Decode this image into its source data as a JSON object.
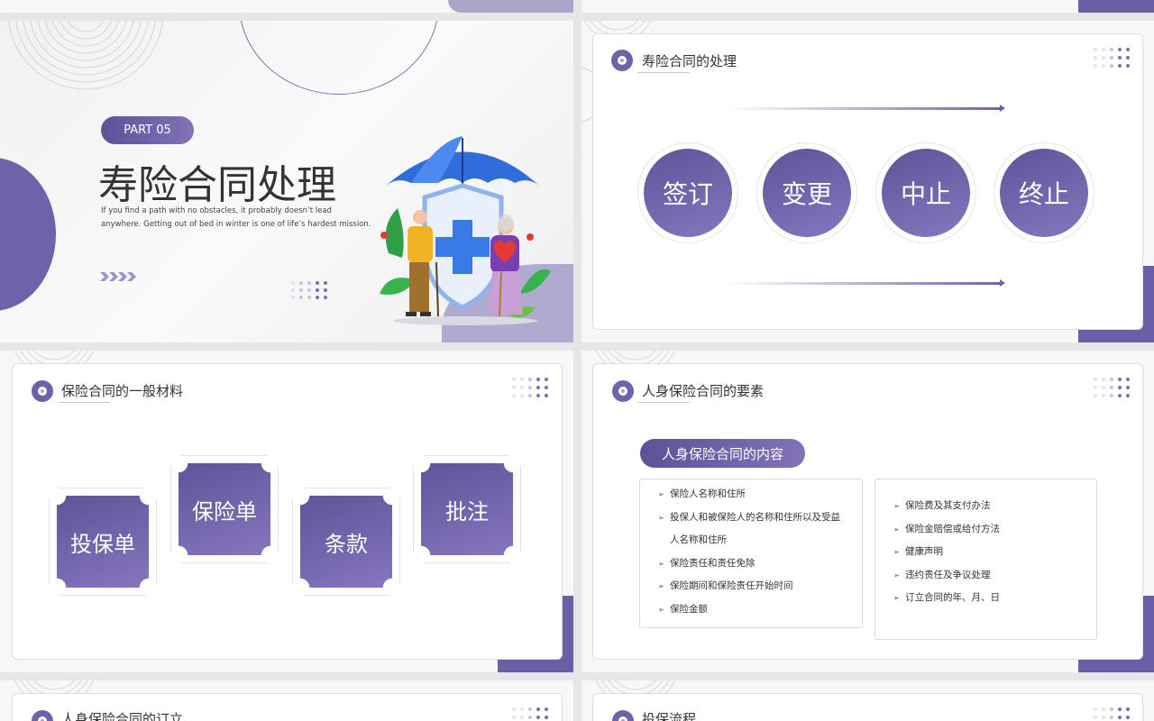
{
  "colors": {
    "accent": "#6e63aa",
    "accent_light": "#8677bf",
    "bg": "#e6e6e6"
  },
  "slide1": {
    "part_label": "PART 05",
    "title": "寿险合同处理",
    "subtitle_line1": "If you find a path with no obstacles, it probably doesn’t lead",
    "subtitle_line2": "anywhere. Getting out of bed in winter is one of life’s hardest mission.",
    "chevrons": "››››",
    "illustration": "umbrella-shield-elderly-couple"
  },
  "slide2": {
    "title": "寿险合同的处理",
    "items": [
      "签订",
      "变更",
      "中止",
      "终止"
    ]
  },
  "slide3": {
    "title": "保险合同的一般材料",
    "items": [
      "投保单",
      "保险单",
      "条款",
      "批注"
    ]
  },
  "slide4": {
    "title": "人身保险合同的要素",
    "pill": "人身保险合同的内容",
    "left_list": [
      "保险人名称和住所",
      "投保人和被保险人的名称和住所以及受益",
      "人名称和住所",
      "保险责任和责任免除",
      "保险期间和保险责任开始时间",
      "保险金额"
    ],
    "right_list": [
      "保险费及其支付办法",
      "保险金赔偿或给付方法",
      "健康声明",
      "违约责任及争议处理",
      "订立合同的年、月、日"
    ]
  },
  "slide5": {
    "title": "人身保险合同的订立"
  },
  "slide6": {
    "title": "投保流程"
  }
}
